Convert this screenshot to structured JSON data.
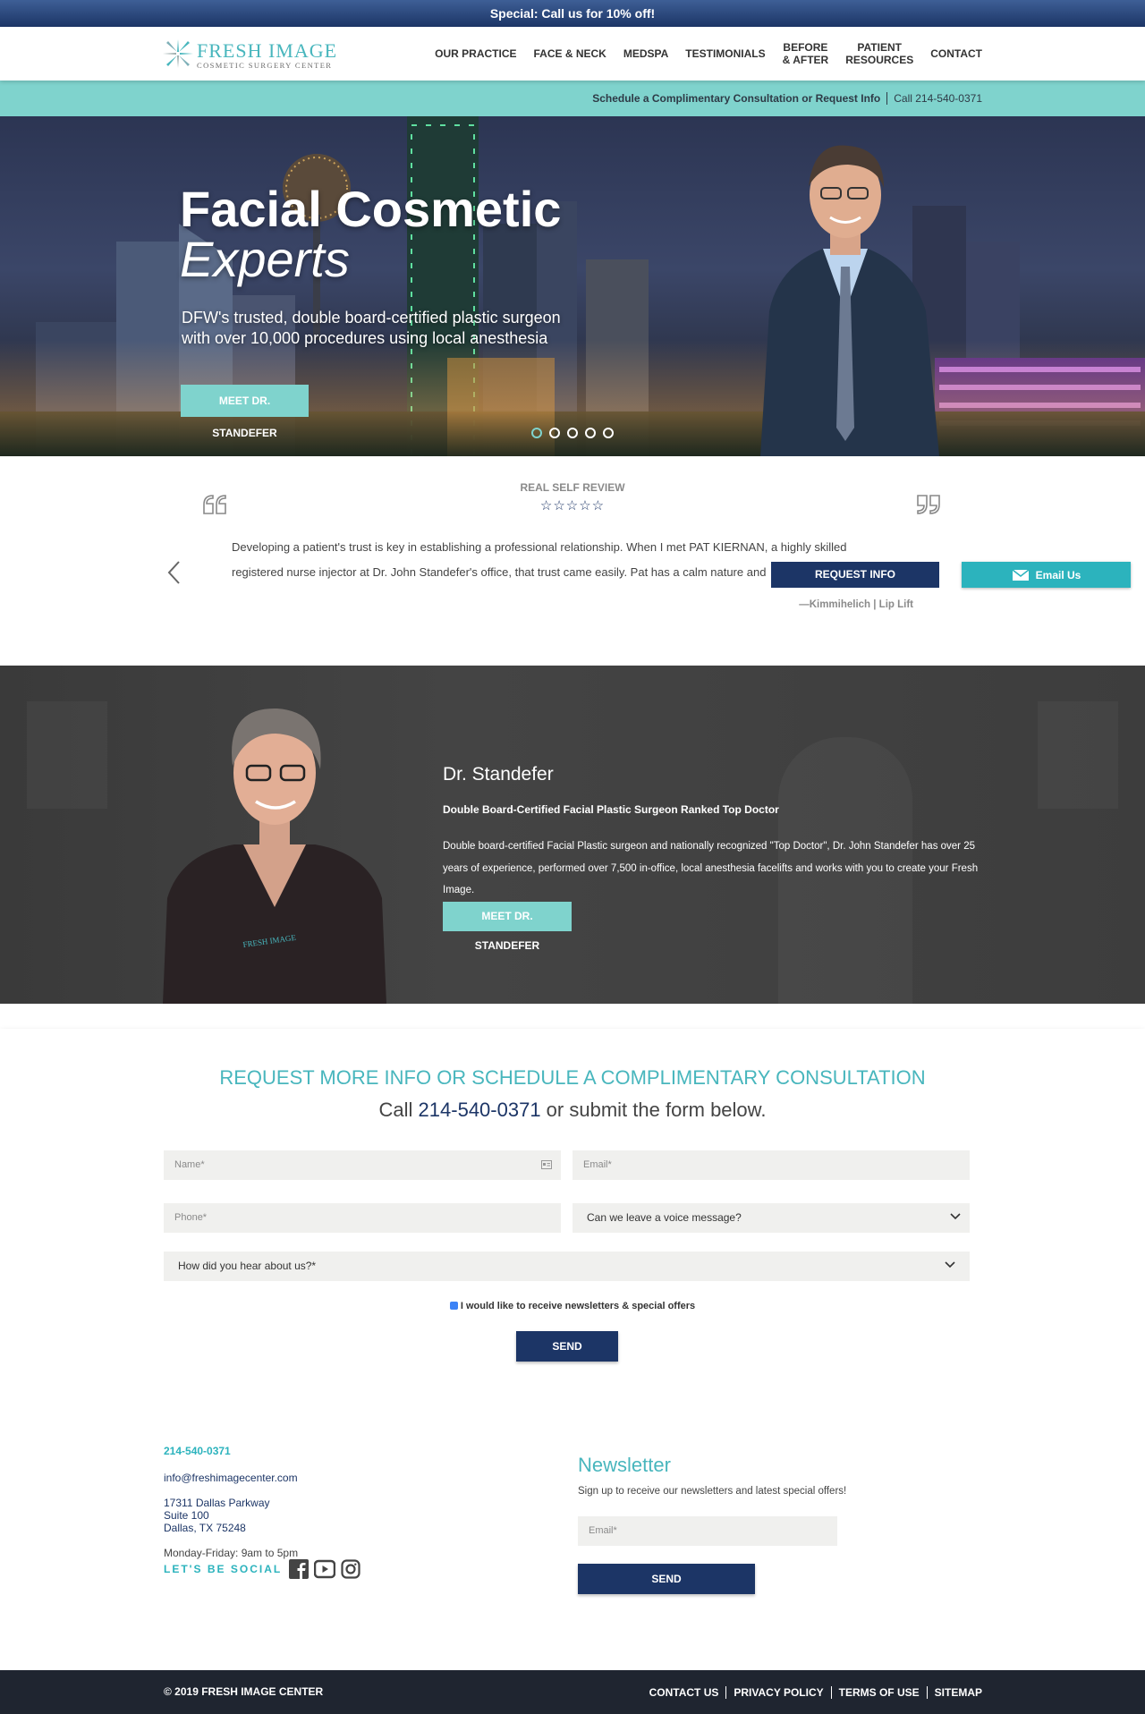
{
  "promo": {
    "text": "Special: Call us for 10% off!"
  },
  "header": {
    "logo_title": "FRESH IMAGE",
    "logo_subtitle": "COSMETIC SURGERY CENTER",
    "nav": [
      {
        "line1": "OUR PRACTICE",
        "line2": ""
      },
      {
        "line1": "FACE & NECK",
        "line2": ""
      },
      {
        "line1": "MEDSPA",
        "line2": ""
      },
      {
        "line1": "TESTIMONIALS",
        "line2": ""
      },
      {
        "line1": "BEFORE",
        "line2": "& AFTER"
      },
      {
        "line1": "PATIENT",
        "line2": "RESOURCES"
      },
      {
        "line1": "CONTACT",
        "line2": ""
      }
    ]
  },
  "schedbar": {
    "schedule": "Schedule a Complimentary Consultation or Request Info",
    "call": "Call 214-540-0371"
  },
  "hero": {
    "title": "Facial Cosmetic",
    "title_italic": "Experts",
    "subtitle": "DFW's trusted, double board-certified plastic surgeon with over 10,000 procedures using local anesthesia",
    "button": "MEET DR. STANDEFER",
    "slides": 5,
    "active_slide": 1
  },
  "review": {
    "title": "REAL SELF REVIEW",
    "stars": "☆☆☆☆☆",
    "text": "Developing a patient's trust is key in establishing a professional relationship. When I met PAT KIERNAN, a highly skilled registered nurse injector at Dr. John Standefer's office, that trust came easily. Pat has a calm nature and",
    "author": "—Kimmihelich | Lip Lift",
    "request_button": "REQUEST INFO",
    "email_button": "Email Us"
  },
  "doctor": {
    "name": "Dr. Standefer",
    "subtitle": "Double Board-Certified Facial Plastic Surgeon Ranked Top Doctor",
    "description": "Double board-certified Facial Plastic surgeon and nationally recognized \"Top Doctor\", Dr. John Standefer has over 25 years of experience, performed over 7,500 in-office, local anesthesia facelifts and works with you to create your Fresh Image.",
    "button": "MEET DR. STANDEFER"
  },
  "form": {
    "title": "REQUEST MORE INFO OR SCHEDULE A COMPLIMENTARY CONSULTATION",
    "sub_pre": "Call ",
    "sub_phone": "214-540-0371",
    "sub_post": " or submit the form below.",
    "name_placeholder": "Name*",
    "email_placeholder": "Email*",
    "phone_placeholder": "Phone*",
    "voice_select": "Can we leave a voice message?",
    "hear_select": "How did you hear about us?*",
    "newsletter_checkbox": "I would like to receive newsletters & special offers",
    "send": "SEND"
  },
  "footer": {
    "phone": "214-540-0371",
    "email": "info@freshimagecenter.com",
    "address1": "17311 Dallas Parkway",
    "address2": "Suite 100",
    "address3": "Dallas, TX 75248",
    "hours": "Monday-Friday: 9am to 5pm",
    "social_label": "LET'S BE SOCIAL",
    "newsletter_title": "Newsletter",
    "newsletter_text": "Sign up to receive our newsletters and latest special offers!",
    "newsletter_email_placeholder": "Email*",
    "newsletter_send": "SEND"
  },
  "bottom": {
    "copyright": "© 2019 FRESH IMAGE CENTER",
    "links": [
      "CONTACT US",
      "PRIVACY POLICY",
      "TERMS OF USE",
      "SITEMAP"
    ]
  },
  "colors": {
    "navy": "#1c3566",
    "teal": "#7fd3cd",
    "teal_dark": "#2cb3bd",
    "teal_text": "#48b6bd",
    "footer_bar": "#1f2530"
  }
}
